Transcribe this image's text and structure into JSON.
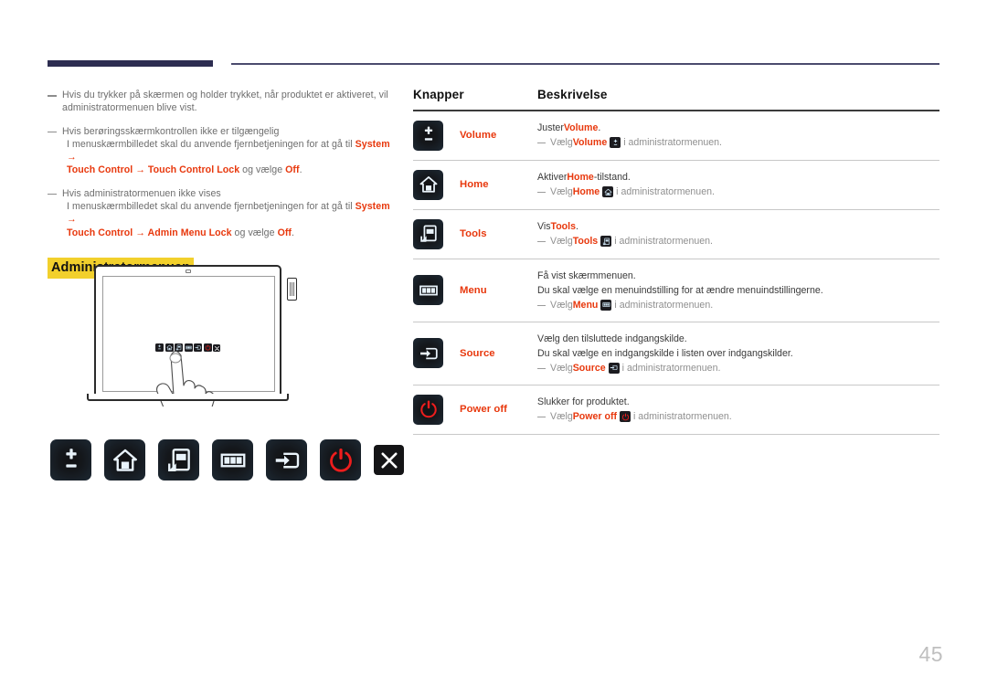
{
  "header": {
    "bar_label": "",
    "rule_label": ""
  },
  "left": {
    "notes": [
      {
        "lines": [
          {
            "parts": [
              {
                "t": "Hvis du trykker på skærmen og holder trykket, når produktet er aktiveret, vil",
                "s": "n"
              }
            ]
          },
          {
            "parts": [
              {
                "t": "administratormenuen blive vist.",
                "s": "n"
              }
            ]
          }
        ]
      },
      {
        "lines": [
          {
            "parts": [
              {
                "t": "Hvis berøringsskærmkontrollen ikke er tilgængelig",
                "s": "n"
              }
            ]
          },
          {
            "indent": true,
            "parts": [
              {
                "t": "I menuskærmbilledet skal du anvende fjernbetjeningen for at gå til ",
                "s": "n"
              },
              {
                "t": "System",
                "s": "r"
              },
              {
                "t": " →",
                "s": "r"
              }
            ]
          },
          {
            "indent": true,
            "parts": [
              {
                "t": "Touch Control",
                "s": "r"
              },
              {
                "t": " → ",
                "s": "r"
              },
              {
                "t": "Touch Control Lock",
                "s": "r"
              },
              {
                "t": " og vælge ",
                "s": "n"
              },
              {
                "t": "Off",
                "s": "r"
              },
              {
                "t": ".",
                "s": "n"
              }
            ]
          }
        ]
      },
      {
        "lines": [
          {
            "parts": [
              {
                "t": "Hvis administratormenuen ikke vises",
                "s": "n"
              }
            ]
          },
          {
            "indent": true,
            "parts": [
              {
                "t": "I menuskærmbilledet skal du anvende fjernbetjeningen for at gå til ",
                "s": "n"
              },
              {
                "t": "System",
                "s": "r"
              },
              {
                "t": " →",
                "s": "r"
              }
            ]
          },
          {
            "indent": true,
            "parts": [
              {
                "t": "Touch Control",
                "s": "r"
              },
              {
                "t": " → ",
                "s": "r"
              },
              {
                "t": "Admin Menu Lock",
                "s": "r"
              },
              {
                "t": " og vælge ",
                "s": "n"
              },
              {
                "t": "Off",
                "s": "r"
              },
              {
                "t": ".",
                "s": "n"
              }
            ]
          }
        ]
      }
    ],
    "section_title": "Administratormenuen",
    "illustration": {
      "name": "tablet-touch-illustration",
      "toolbar_icons": [
        "volume-icon",
        "home-icon",
        "tools-icon",
        "menu-icon",
        "source-icon",
        "power-off-icon",
        "close-icon"
      ]
    },
    "big_buttons": [
      {
        "name": "volume-button",
        "icon": "volume-icon"
      },
      {
        "name": "home-button",
        "icon": "home-icon"
      },
      {
        "name": "tools-button",
        "icon": "tools-icon"
      },
      {
        "name": "menu-button",
        "icon": "menu-icon"
      },
      {
        "name": "source-button",
        "icon": "source-icon"
      },
      {
        "name": "power-off-button",
        "icon": "power-off-icon"
      },
      {
        "name": "close-button",
        "icon": "close-icon"
      }
    ]
  },
  "table": {
    "headers": {
      "buttons": "Knapper",
      "description": "Beskrivelse"
    },
    "rows": [
      {
        "icon": "volume-icon",
        "name": "Volume",
        "lines": [
          {
            "type": "main",
            "parts": [
              {
                "t": "Juster ",
                "s": "n"
              },
              {
                "t": "Volume",
                "s": "r"
              },
              {
                "t": ".",
                "s": "n"
              }
            ]
          },
          {
            "type": "sub",
            "parts": [
              {
                "t": "Vælg ",
                "s": "n"
              },
              {
                "t": "Volume",
                "s": "r"
              },
              {
                "t": "ICON",
                "s": "i"
              },
              {
                "t": "i administratormenuen.",
                "s": "n"
              }
            ]
          }
        ]
      },
      {
        "icon": "home-icon",
        "name": "Home",
        "lines": [
          {
            "type": "main",
            "parts": [
              {
                "t": "Aktiver ",
                "s": "n"
              },
              {
                "t": "Home",
                "s": "r"
              },
              {
                "t": "-tilstand.",
                "s": "n"
              }
            ]
          },
          {
            "type": "sub",
            "parts": [
              {
                "t": "Vælg ",
                "s": "n"
              },
              {
                "t": "Home",
                "s": "r"
              },
              {
                "t": "ICON",
                "s": "i"
              },
              {
                "t": "i administratormenuen.",
                "s": "n"
              }
            ]
          }
        ]
      },
      {
        "icon": "tools-icon",
        "name": "Tools",
        "lines": [
          {
            "type": "main",
            "parts": [
              {
                "t": "Vis ",
                "s": "n"
              },
              {
                "t": "Tools",
                "s": "r"
              },
              {
                "t": ".",
                "s": "n"
              }
            ]
          },
          {
            "type": "sub",
            "parts": [
              {
                "t": "Vælg ",
                "s": "n"
              },
              {
                "t": "Tools",
                "s": "r"
              },
              {
                "t": "ICON",
                "s": "i"
              },
              {
                "t": "i administratormenuen.",
                "s": "n"
              }
            ]
          }
        ]
      },
      {
        "icon": "menu-icon",
        "name": "Menu",
        "lines": [
          {
            "type": "main",
            "parts": [
              {
                "t": "Få vist skærmmenuen.",
                "s": "n"
              }
            ]
          },
          {
            "type": "main",
            "parts": [
              {
                "t": "Du skal vælge en menuindstilling for at ændre menuindstillingerne.",
                "s": "n"
              }
            ]
          },
          {
            "type": "sub",
            "parts": [
              {
                "t": "Vælg ",
                "s": "n"
              },
              {
                "t": "Menu",
                "s": "r"
              },
              {
                "t": "ICON",
                "s": "i"
              },
              {
                "t": "i administratormenuen.",
                "s": "n"
              }
            ]
          }
        ]
      },
      {
        "icon": "source-icon",
        "name": "Source",
        "lines": [
          {
            "type": "main",
            "parts": [
              {
                "t": "Vælg den tilsluttede indgangskilde.",
                "s": "n"
              }
            ]
          },
          {
            "type": "main",
            "parts": [
              {
                "t": "Du skal vælge en indgangskilde i listen over indgangskilder.",
                "s": "n"
              }
            ]
          },
          {
            "type": "sub",
            "parts": [
              {
                "t": "Vælg ",
                "s": "n"
              },
              {
                "t": "Source",
                "s": "r"
              },
              {
                "t": "ICON",
                "s": "i"
              },
              {
                "t": "i administratormenuen.",
                "s": "n"
              }
            ]
          }
        ]
      },
      {
        "icon": "power-off-icon",
        "name": "Power off",
        "lines": [
          {
            "type": "main",
            "parts": [
              {
                "t": "Slukker for produktet.",
                "s": "n"
              }
            ]
          },
          {
            "type": "sub",
            "parts": [
              {
                "t": "Vælg ",
                "s": "n"
              },
              {
                "t": "Power off",
                "s": "r"
              },
              {
                "t": "ICON",
                "s": "i"
              },
              {
                "t": "i administratormenuen.",
                "s": "n"
              }
            ]
          }
        ]
      }
    ]
  },
  "footer": {
    "page_number": "45"
  },
  "colors": {
    "accent_red": "#e8380d",
    "highlight_yellow": "#f2d02c",
    "rule_navy": "#2d2d51",
    "body_gray": "#6d6d6d",
    "key_black": "#121214"
  }
}
